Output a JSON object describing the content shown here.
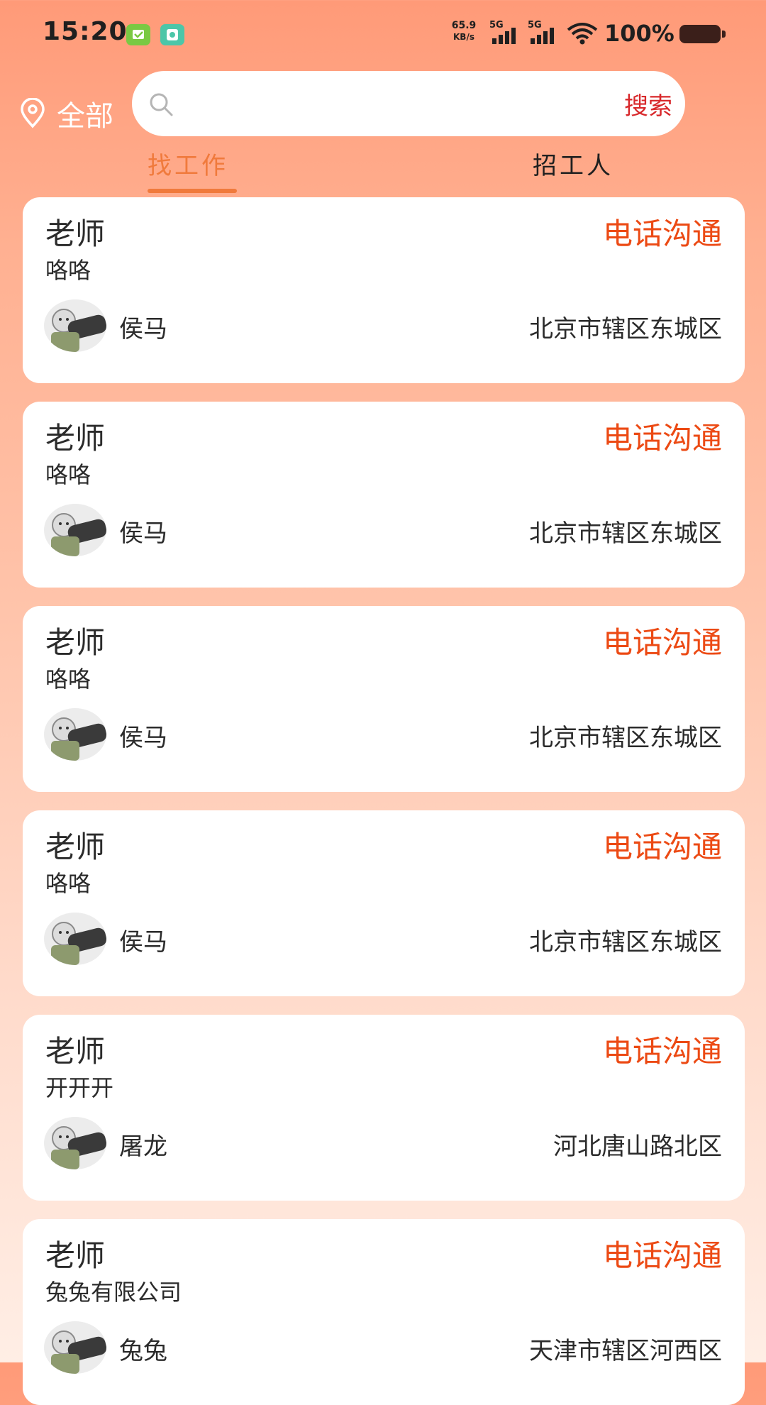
{
  "status_bar": {
    "time": "15:20",
    "net_speed": "65.9",
    "net_speed_unit": "KB/s",
    "signal_1_label": "5G",
    "signal_2_label": "5G",
    "battery": "100%"
  },
  "header": {
    "location_label": "全部",
    "search_placeholder": "",
    "search_button": "搜索"
  },
  "tabs": [
    {
      "label": "找工作",
      "active": true
    },
    {
      "label": "招工人",
      "active": false
    }
  ],
  "jobs": [
    {
      "title": "老师",
      "company": "咯咯",
      "user": "侯马",
      "location": "北京市辖区东城区",
      "call_label": "电话沟通"
    },
    {
      "title": "老师",
      "company": "咯咯",
      "user": "侯马",
      "location": "北京市辖区东城区",
      "call_label": "电话沟通"
    },
    {
      "title": "老师",
      "company": "咯咯",
      "user": "侯马",
      "location": "北京市辖区东城区",
      "call_label": "电话沟通"
    },
    {
      "title": "老师",
      "company": "咯咯",
      "user": "侯马",
      "location": "北京市辖区东城区",
      "call_label": "电话沟通"
    },
    {
      "title": "老师",
      "company": "开开开",
      "user": "屠龙",
      "location": "河北唐山路北区",
      "call_label": "电话沟通"
    },
    {
      "title": "老师",
      "company": "兔兔有限公司",
      "user": "兔兔",
      "location": "天津市辖区河西区",
      "call_label": "电话沟通"
    }
  ],
  "colors": {
    "accent": "#F07A3C",
    "call": "#EC4A14",
    "search_button": "#D8282B"
  }
}
